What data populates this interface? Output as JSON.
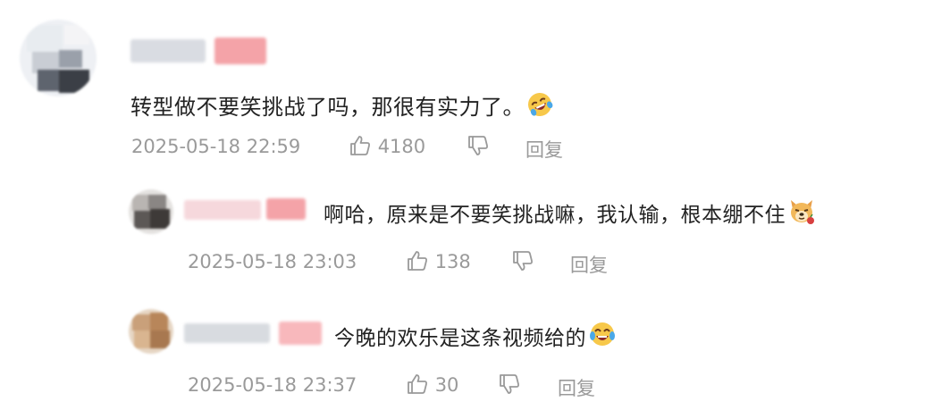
{
  "comments": [
    {
      "text": "转型做不要笑挑战了吗，那很有实力了。",
      "emoji": "rolling-on-floor-laughing-emoji",
      "timestamp": "2025-05-18 22:59",
      "likes": "4180",
      "reply_label": "回复"
    },
    {
      "text": "啊哈，原来是不要笑挑战嘛，我认输，根本绷不住",
      "emoji": "dog-face-emoji",
      "timestamp": "2025-05-18 23:03",
      "likes": "138",
      "reply_label": "回复"
    },
    {
      "text": "今晚的欢乐是这条视频给的",
      "emoji": "tears-of-joy-emoji",
      "timestamp": "2025-05-18 23:37",
      "likes": "30",
      "reply_label": "回复"
    }
  ],
  "colors": {
    "text": "#222222",
    "meta": "#9a9a9a",
    "background": "#ffffff",
    "name_badge": "#f4a3a8"
  },
  "icons": [
    "thumbs-up-icon",
    "thumbs-down-icon"
  ]
}
